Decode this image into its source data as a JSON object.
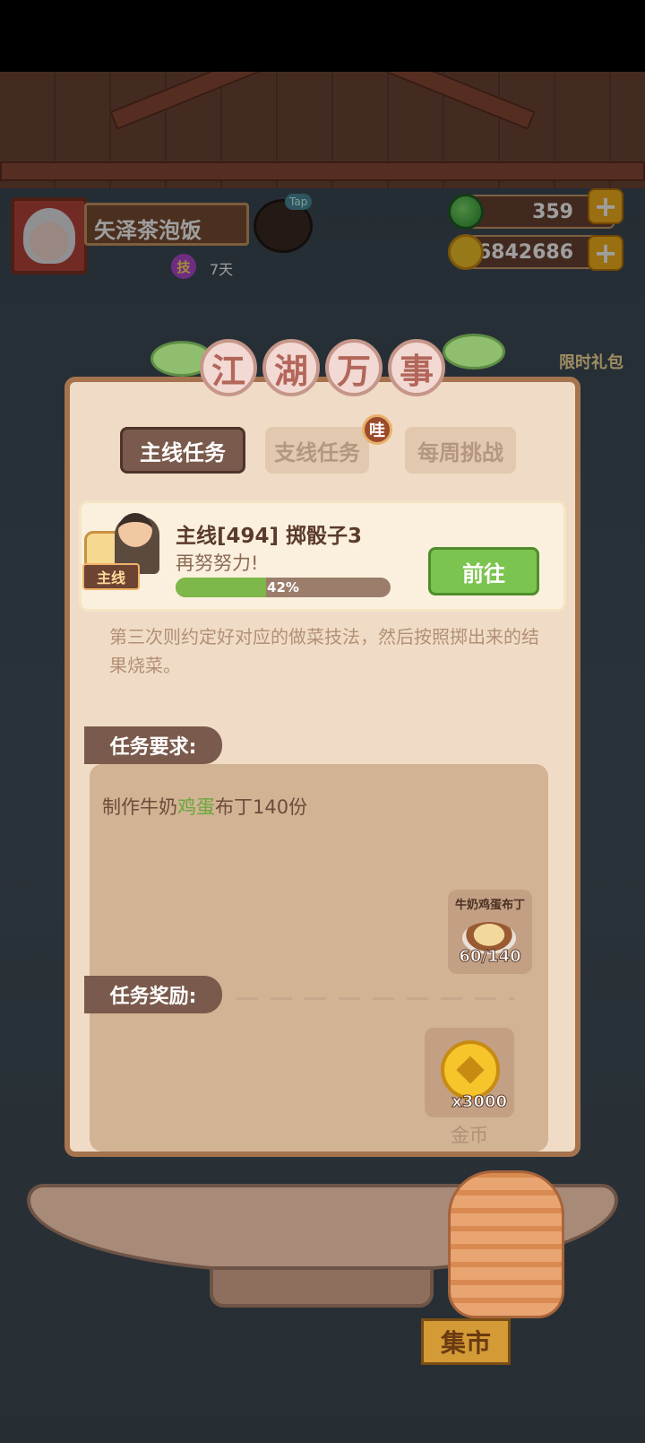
{
  "player": {
    "name": "矢泽茶泡饭",
    "skill_badge": "技",
    "days": "7天",
    "tap_label": "Tap"
  },
  "currencies": {
    "jade": "359",
    "coins": "6842686",
    "plus": "+"
  },
  "side": {
    "gift_label": "限时礼包",
    "market_label": "集市"
  },
  "panel": {
    "title_chars": [
      "江",
      "湖",
      "万",
      "事"
    ],
    "tabs": {
      "main": "主线任务",
      "side": "支线任务",
      "weekly": "每周挑战"
    },
    "new_badge": "哇",
    "quest": {
      "tag": "主线",
      "title": "主线[494] 掷骰子3",
      "subtitle": "再努努力!",
      "progress": 0.42,
      "progress_text": "42%",
      "go_label": "前往",
      "description": "第三次则约定好对应的做菜技法，然后按照掷出来的结果烧菜。"
    },
    "requirements": {
      "label": "任务要求:",
      "text_before": "制作牛奶",
      "text_highlight": "鸡蛋",
      "text_after": "布丁140份",
      "dish_name": "牛奶鸡蛋布丁",
      "dish_count": "60/140"
    },
    "rewards": {
      "label": "任务奖励:",
      "qty": "x3000",
      "name": "金币"
    }
  },
  "colors": {
    "accent_green": "#7cc450",
    "label_brown": "#7a5a4c",
    "panel_bg": "#f0dcc6"
  }
}
